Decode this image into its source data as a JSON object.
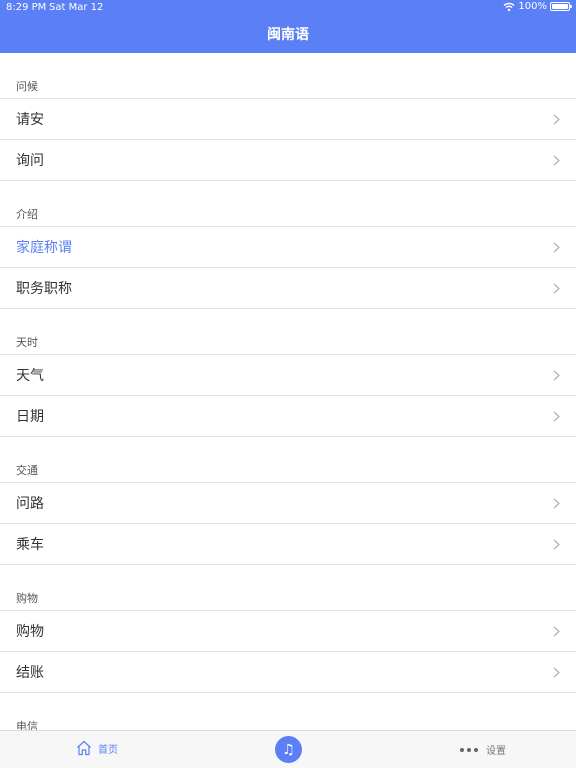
{
  "status": {
    "time": "8:29 PM",
    "date": "Sat Mar 12",
    "battery": "100%"
  },
  "header": {
    "title": "闽南语"
  },
  "sections": [
    {
      "title": "问候",
      "items": [
        {
          "label": "请安"
        },
        {
          "label": "询问"
        }
      ]
    },
    {
      "title": "介绍",
      "items": [
        {
          "label": "家庭称谓",
          "active": true
        },
        {
          "label": "职务职称"
        }
      ]
    },
    {
      "title": "天时",
      "items": [
        {
          "label": "天气"
        },
        {
          "label": "日期"
        }
      ]
    },
    {
      "title": "交通",
      "items": [
        {
          "label": "问路"
        },
        {
          "label": "乘车"
        }
      ]
    },
    {
      "title": "购物",
      "items": [
        {
          "label": "购物"
        },
        {
          "label": "结账"
        }
      ]
    },
    {
      "title": "电信",
      "items": []
    }
  ],
  "tabbar": {
    "home_label": "首页",
    "music_icon": "♫",
    "settings_label": "设置"
  },
  "colors": {
    "accent": "#5b7ff5"
  }
}
